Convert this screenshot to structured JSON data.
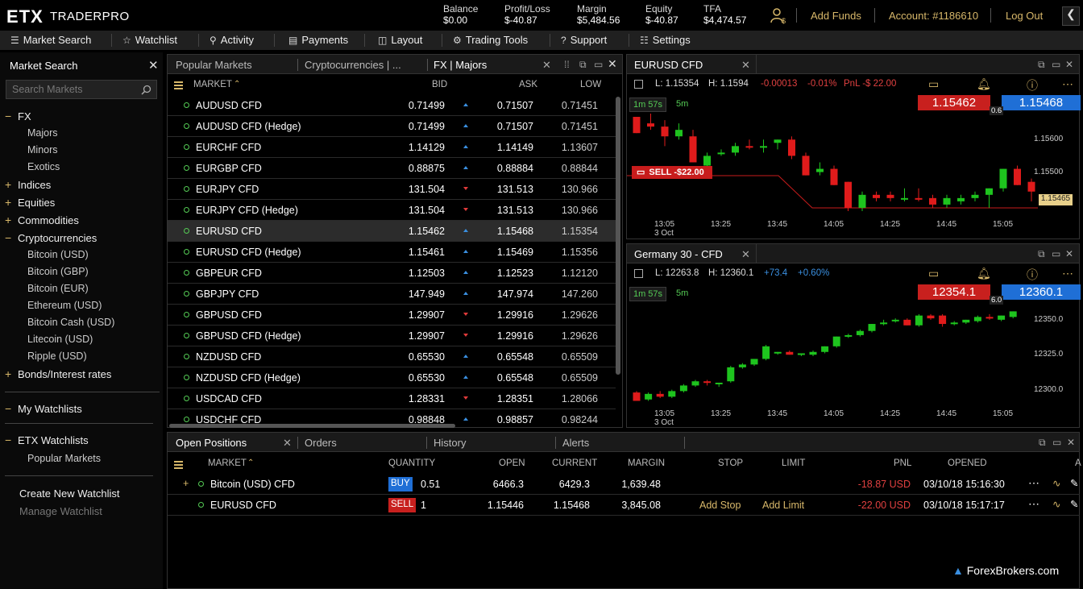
{
  "app": {
    "logo": "ETX",
    "name": "TRADERPRO"
  },
  "header": {
    "stats": [
      {
        "label": "Balance",
        "value": "$0.00"
      },
      {
        "label": "Profit/Loss",
        "value": "$-40.87"
      },
      {
        "label": "Margin",
        "value": "$5,484.56"
      },
      {
        "label": "Equity",
        "value": "$-40.87"
      },
      {
        "label": "TFA",
        "value": "$4,474.57"
      }
    ],
    "add_funds": "Add Funds",
    "account": "Account: #1186610",
    "logout": "Log Out"
  },
  "nav": [
    "Market Search",
    "Watchlist",
    "Activity",
    "Payments",
    "Layout",
    "Trading Tools",
    "Support",
    "Settings"
  ],
  "sidebar": {
    "title": "Market Search",
    "search_placeholder": "Search Markets",
    "categories": [
      {
        "label": "FX",
        "mark": "−"
      },
      {
        "label": "Indices",
        "mark": "+"
      },
      {
        "label": "Equities",
        "mark": "+"
      },
      {
        "label": "Commodities",
        "mark": "+"
      },
      {
        "label": "Cryptocurrencies",
        "mark": "−"
      },
      {
        "label": "Bonds/Interest rates",
        "mark": "+"
      }
    ],
    "fx_sub": [
      "Majors",
      "Minors",
      "Exotics"
    ],
    "crypto_sub": [
      "Bitcoin (USD)",
      "Bitcoin (GBP)",
      "Bitcoin (EUR)",
      "Ethereum (USD)",
      "Bitcoin Cash (USD)",
      "Litecoin (USD)",
      "Ripple (USD)"
    ],
    "my_watchlists": "My Watchlists",
    "etx_watchlists": "ETX Watchlists",
    "popular_markets": "Popular Markets",
    "create": "Create New Watchlist",
    "manage": "Manage Watchlist"
  },
  "market_panel": {
    "tabs": [
      "Popular Markets",
      "Cryptocurrencies | ...",
      "FX | Majors"
    ],
    "columns": {
      "market": "MARKET",
      "bid": "BID",
      "ask": "ASK",
      "low": "LOW"
    },
    "rows": [
      {
        "name": "AUDUSD CFD",
        "bid": "0.71499",
        "dir": "up",
        "ask": "0.71507",
        "low": "0.71451"
      },
      {
        "name": "AUDUSD CFD (Hedge)",
        "bid": "0.71499",
        "dir": "up",
        "ask": "0.71507",
        "low": "0.71451"
      },
      {
        "name": "EURCHF CFD",
        "bid": "1.14129",
        "dir": "up",
        "ask": "1.14149",
        "low": "1.13607"
      },
      {
        "name": "EURGBP CFD",
        "bid": "0.88875",
        "dir": "up",
        "ask": "0.88884",
        "low": "0.88844"
      },
      {
        "name": "EURJPY CFD",
        "bid": "131.504",
        "dir": "down",
        "ask": "131.513",
        "low": "130.966"
      },
      {
        "name": "EURJPY CFD (Hedge)",
        "bid": "131.504",
        "dir": "down",
        "ask": "131.513",
        "low": "130.966"
      },
      {
        "name": "EURUSD CFD",
        "bid": "1.15462",
        "dir": "up",
        "ask": "1.15468",
        "low": "1.15354"
      },
      {
        "name": "EURUSD CFD (Hedge)",
        "bid": "1.15461",
        "dir": "up",
        "ask": "1.15469",
        "low": "1.15356"
      },
      {
        "name": "GBPEUR CFD",
        "bid": "1.12503",
        "dir": "up",
        "ask": "1.12523",
        "low": "1.12120"
      },
      {
        "name": "GBPJPY CFD",
        "bid": "147.949",
        "dir": "up",
        "ask": "147.974",
        "low": "147.260"
      },
      {
        "name": "GBPUSD CFD",
        "bid": "1.29907",
        "dir": "down",
        "ask": "1.29916",
        "low": "1.29626"
      },
      {
        "name": "GBPUSD CFD (Hedge)",
        "bid": "1.29907",
        "dir": "down",
        "ask": "1.29916",
        "low": "1.29626"
      },
      {
        "name": "NZDUSD CFD",
        "bid": "0.65530",
        "dir": "up",
        "ask": "0.65548",
        "low": "0.65509"
      },
      {
        "name": "NZDUSD CFD (Hedge)",
        "bid": "0.65530",
        "dir": "up",
        "ask": "0.65548",
        "low": "0.65509"
      },
      {
        "name": "USDCAD CFD",
        "bid": "1.28331",
        "dir": "down",
        "ask": "1.28351",
        "low": "1.28066"
      },
      {
        "name": "USDCHF CFD",
        "bid": "0.98848",
        "dir": "up",
        "ask": "0.98857",
        "low": "0.98244"
      }
    ]
  },
  "charts": [
    {
      "title": "EURUSD CFD",
      "low": "L: 1.15354",
      "high": "H: 1.1594",
      "chg": "-0.00013",
      "pct": "-0.01%",
      "pnl": "PnL -$ 22.00",
      "tf": "1m 57s",
      "tf2": "5m",
      "bid": "1.15462",
      "ask": "1.15468",
      "spread": "0.6",
      "sell_tag": "SELL -$22.00",
      "last_tag": "1.15465",
      "yticks": [
        "1.15600",
        "1.15500"
      ],
      "xticks": [
        "13:05",
        "13:25",
        "13:45",
        "14:05",
        "14:25",
        "14:45",
        "15:05"
      ],
      "date": "3 Oct",
      "candles": [
        [
          1.1567,
          1.1567,
          1.1562,
          1.1562,
          "d"
        ],
        [
          1.1565,
          1.1568,
          1.1563,
          1.1564,
          "d"
        ],
        [
          1.1564,
          1.1566,
          1.1558,
          1.1561,
          "d"
        ],
        [
          1.1563,
          1.1565,
          1.156,
          1.1561,
          "u"
        ],
        [
          1.1561,
          1.1563,
          1.1553,
          1.1553,
          "d"
        ],
        [
          1.1552,
          1.1556,
          1.1551,
          1.1555,
          "u"
        ],
        [
          1.1556,
          1.1557,
          1.1555,
          1.1556,
          "u"
        ],
        [
          1.1556,
          1.1559,
          1.1555,
          1.1558,
          "u"
        ],
        [
          1.1558,
          1.156,
          1.1557,
          1.1558,
          "d"
        ],
        [
          1.1558,
          1.156,
          1.1556,
          1.1558,
          "u"
        ],
        [
          1.1559,
          1.156,
          1.1557,
          1.156,
          "u"
        ],
        [
          1.156,
          1.1561,
          1.1554,
          1.1555,
          "d"
        ],
        [
          1.1555,
          1.1556,
          1.1549,
          1.1549,
          "d"
        ],
        [
          1.155,
          1.1553,
          1.1549,
          1.1551,
          "u"
        ],
        [
          1.1551,
          1.1552,
          1.1546,
          1.1546,
          "d"
        ],
        [
          1.1547,
          1.1547,
          1.1538,
          1.1539,
          "d"
        ],
        [
          1.1539,
          1.1544,
          1.1538,
          1.1543,
          "u"
        ],
        [
          1.1543,
          1.1544,
          1.1541,
          1.1542,
          "d"
        ],
        [
          1.1543,
          1.1544,
          1.1541,
          1.1542,
          "d"
        ],
        [
          1.1542,
          1.1545,
          1.1541,
          1.1542,
          "u"
        ],
        [
          1.1542,
          1.1545,
          1.1541,
          1.1542,
          "d"
        ],
        [
          1.1542,
          1.1543,
          1.1539,
          1.154,
          "d"
        ],
        [
          1.154,
          1.1543,
          1.1539,
          1.1542,
          "u"
        ],
        [
          1.1541,
          1.1543,
          1.154,
          1.1542,
          "u"
        ],
        [
          1.1542,
          1.1544,
          1.1541,
          1.1543,
          "u"
        ],
        [
          1.1543,
          1.1545,
          1.1539,
          1.1545,
          "u"
        ],
        [
          1.1545,
          1.1551,
          1.1544,
          1.1551,
          "u"
        ],
        [
          1.1551,
          1.1552,
          1.1546,
          1.1546,
          "d"
        ],
        [
          1.1547,
          1.1548,
          1.1541,
          1.1544,
          "d"
        ],
        [
          1.1545,
          1.1546,
          1.1541,
          1.1542,
          "d"
        ]
      ],
      "ymin": 1.1537,
      "ymax": 1.1568
    },
    {
      "title": "Germany 30 - CFD",
      "low": "L: 12263.8",
      "high": "H: 12360.1",
      "chg": "+73.4",
      "pct": "+0.60%",
      "pnl": "",
      "tf": "1m 57s",
      "tf2": "5m",
      "bid": "12354.1",
      "ask": "12360.1",
      "spread": "6.0",
      "sell_tag": "",
      "last_tag": "",
      "yticks": [
        "12350.0",
        "12325.0",
        "12300.0"
      ],
      "xticks": [
        "13:05",
        "13:25",
        "13:45",
        "14:05",
        "14:25",
        "14:45",
        "15:05"
      ],
      "date": "3 Oct",
      "candles": [
        [
          12298,
          12299,
          12292,
          12292,
          "d"
        ],
        [
          12293,
          12298,
          12292,
          12297,
          "u"
        ],
        [
          12297,
          12299,
          12294,
          12295,
          "d"
        ],
        [
          12295,
          12300,
          12294,
          12299,
          "u"
        ],
        [
          12299,
          12304,
          12298,
          12303,
          "u"
        ],
        [
          12303,
          12307,
          12302,
          12306,
          "u"
        ],
        [
          12306,
          12307,
          12303,
          12305,
          "d"
        ],
        [
          12304,
          12305,
          12302,
          12305,
          "u"
        ],
        [
          12306,
          12317,
          12305,
          12316,
          "u"
        ],
        [
          12316,
          12319,
          12315,
          12318,
          "u"
        ],
        [
          12318,
          12322,
          12317,
          12322,
          "u"
        ],
        [
          12322,
          12332,
          12321,
          12331,
          "u"
        ],
        [
          12326,
          12327,
          12325,
          12327,
          "u"
        ],
        [
          12327,
          12328,
          12325,
          12325,
          "d"
        ],
        [
          12325,
          12326,
          12324,
          12326,
          "u"
        ],
        [
          12325,
          12328,
          12324,
          12327,
          "u"
        ],
        [
          12327,
          12331,
          12326,
          12331,
          "u"
        ],
        [
          12331,
          12338,
          12330,
          12338,
          "u"
        ],
        [
          12338,
          12340,
          12337,
          12339,
          "u"
        ],
        [
          12339,
          12343,
          12338,
          12342,
          "u"
        ],
        [
          12342,
          12347,
          12341,
          12347,
          "u"
        ],
        [
          12347,
          12350,
          12346,
          12348,
          "u"
        ],
        [
          12349,
          12351,
          12348,
          12350,
          "u"
        ],
        [
          12350,
          12351,
          12346,
          12346,
          "d"
        ],
        [
          12346,
          12354,
          12345,
          12353,
          "u"
        ],
        [
          12353,
          12354,
          12350,
          12351,
          "d"
        ],
        [
          12353,
          12354,
          12345,
          12347,
          "d"
        ],
        [
          12347,
          12349,
          12346,
          12348,
          "u"
        ],
        [
          12348,
          12350,
          12347,
          12350,
          "u"
        ],
        [
          12349,
          12353,
          12348,
          12352,
          "u"
        ],
        [
          12352,
          12354,
          12350,
          12351,
          "d"
        ],
        [
          12350,
          12353,
          12349,
          12353,
          "u"
        ],
        [
          12352,
          12356,
          12351,
          12356,
          "u"
        ]
      ],
      "ymin": 12290,
      "ymax": 12362
    }
  ],
  "positions": {
    "tabs": [
      "Open Positions",
      "Orders",
      "History",
      "Alerts"
    ],
    "columns": [
      "MARKET",
      "QUANTITY",
      "OPEN",
      "CURRENT",
      "MARGIN",
      "STOP",
      "LIMIT",
      "PNL",
      "OPENED",
      "A"
    ],
    "rows": [
      {
        "expand": "+",
        "name": "Bitcoin (USD) CFD",
        "side": "BUY",
        "qty": "0.51",
        "open": "6466.3",
        "current": "6429.3",
        "margin": "1,639.48",
        "stop": "",
        "limit": "",
        "pnl": "-18.87 USD",
        "opened": "03/10/18 15:16:30"
      },
      {
        "expand": "",
        "name": "EURUSD CFD",
        "side": "SELL",
        "qty": "1",
        "open": "1.15446",
        "current": "1.15468",
        "margin": "3,845.08",
        "stop": "Add Stop",
        "limit": "Add Limit",
        "pnl": "-22.00 USD",
        "opened": "03/10/18 15:17:17"
      }
    ]
  },
  "watermark": "ForexBrokers.com",
  "colors": {
    "gold": "#d8b86a",
    "up": "#1ec41e",
    "down": "#e01b1b",
    "bid_box": "#c8201e",
    "ask_box": "#1f6fd6"
  }
}
